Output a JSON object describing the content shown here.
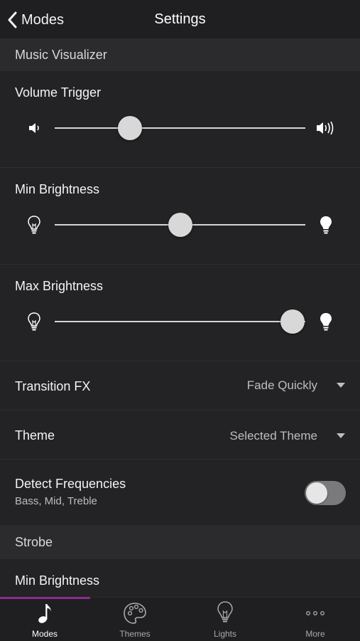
{
  "nav": {
    "back_label": "Modes",
    "title": "Settings"
  },
  "music_visualizer": {
    "header": "Music Visualizer",
    "volume_trigger": {
      "label": "Volume Trigger",
      "value_percent": 30,
      "left_icon": "speaker-low-icon",
      "right_icon": "speaker-high-icon"
    },
    "min_brightness": {
      "label": "Min Brightness",
      "value_percent": 50,
      "left_icon": "bulb-outline-icon",
      "right_icon": "bulb-filled-icon"
    },
    "max_brightness": {
      "label": "Max Brightness",
      "value_percent": 95,
      "left_icon": "bulb-outline-icon",
      "right_icon": "bulb-filled-icon"
    },
    "transition_fx": {
      "label": "Transition FX",
      "value": "Fade Quickly"
    },
    "theme": {
      "label": "Theme",
      "value": "Selected Theme"
    },
    "detect_frequencies": {
      "label": "Detect Frequencies",
      "sublabel": "Bass, Mid, Treble",
      "enabled": false
    }
  },
  "strobe": {
    "header": "Strobe",
    "min_brightness": {
      "label": "Min Brightness"
    }
  },
  "tabs": [
    {
      "label": "Modes",
      "icon": "music-note-icon",
      "active": true
    },
    {
      "label": "Themes",
      "icon": "palette-icon",
      "active": false
    },
    {
      "label": "Lights",
      "icon": "bulb-icon",
      "active": false
    },
    {
      "label": "More",
      "icon": "more-dots-icon",
      "active": false
    }
  ],
  "colors": {
    "background": "#232325",
    "section_header": "#2b2b2e",
    "accent": "#8e2a8a"
  }
}
